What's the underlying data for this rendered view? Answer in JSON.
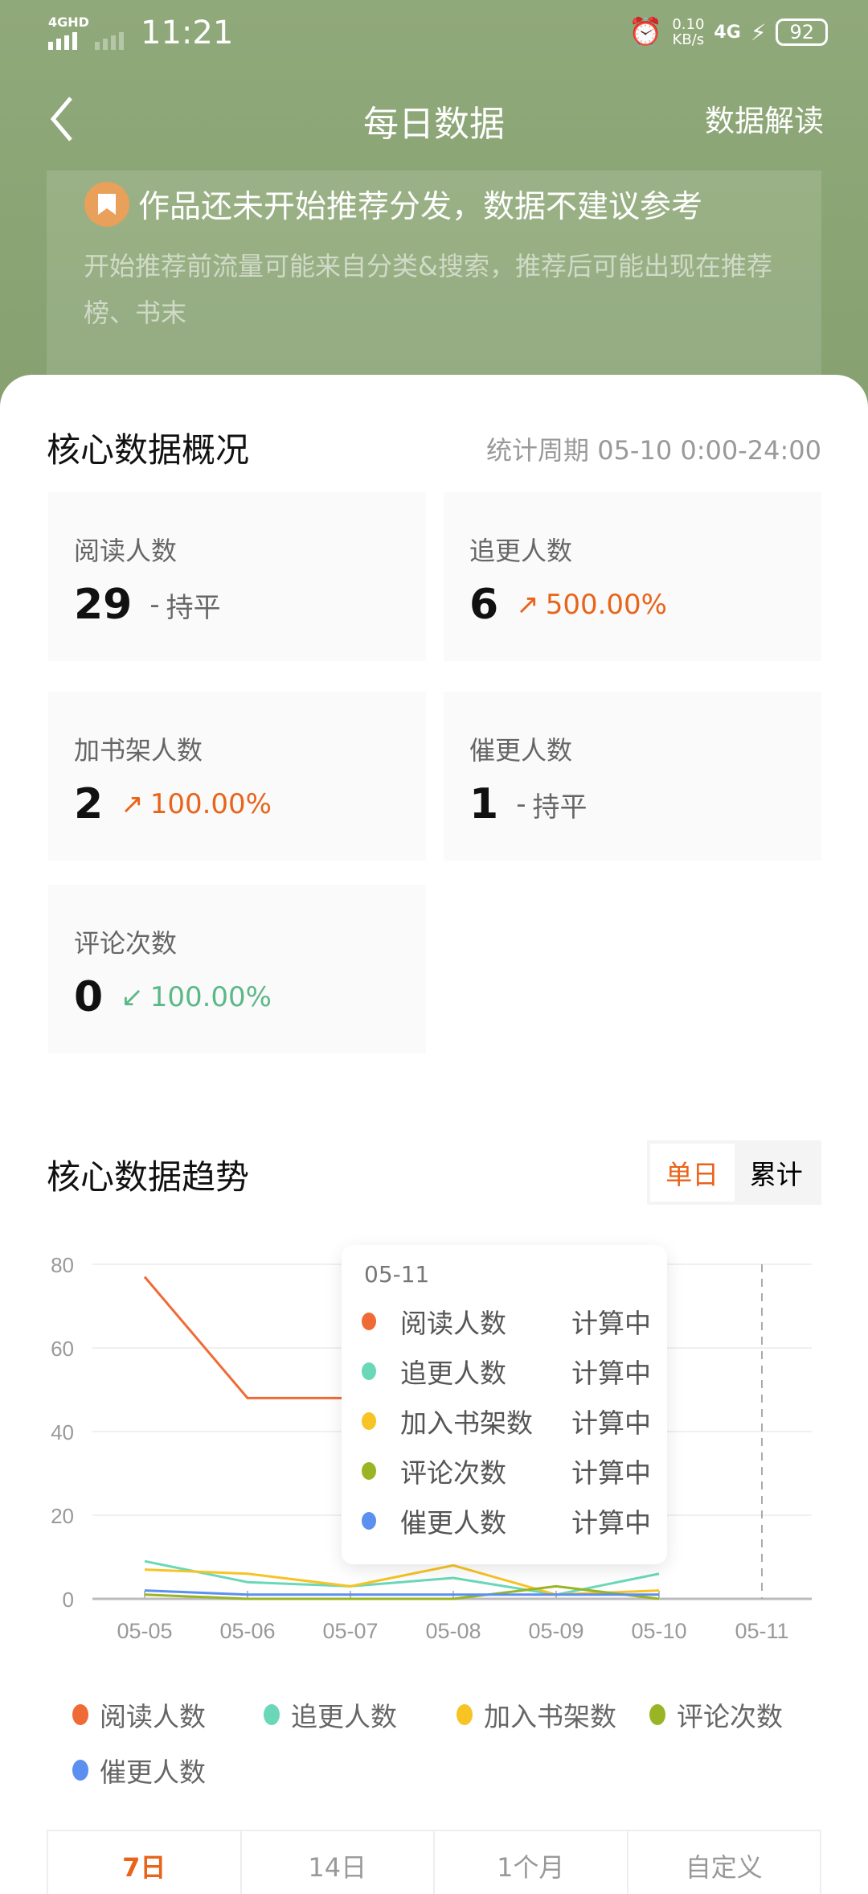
{
  "status_bar": {
    "network": "4GHD",
    "time": "11:21",
    "speed": "0.10",
    "speed_unit": "KB/s",
    "net2": "4G",
    "battery": "92"
  },
  "nav": {
    "title": "每日数据",
    "right": "数据解读"
  },
  "banner": {
    "title": "作品还未开始推荐分发，数据不建议参考",
    "subtitle": "开始推荐前流量可能来自分类&搜索，推荐后可能出现在推荐榜、书末"
  },
  "overview": {
    "title": "核心数据概况",
    "period": "统计周期 05-10 0:00-24:00",
    "stats": [
      {
        "label": "阅读人数",
        "value": "29",
        "change": "持平",
        "trend": "flat"
      },
      {
        "label": "追更人数",
        "value": "6",
        "change": "500.00%",
        "trend": "up"
      },
      {
        "label": "加书架人数",
        "value": "2",
        "change": "100.00%",
        "trend": "up"
      },
      {
        "label": "催更人数",
        "value": "1",
        "change": "持平",
        "trend": "flat"
      },
      {
        "label": "评论次数",
        "value": "0",
        "change": "100.00%",
        "trend": "down"
      }
    ]
  },
  "trend": {
    "title": "核心数据趋势",
    "toggle": [
      "单日",
      "累计"
    ],
    "active_toggle": "单日",
    "tooltip": {
      "date": "05-11",
      "rows": [
        {
          "name": "阅读人数",
          "value": "计算中"
        },
        {
          "name": "追更人数",
          "value": "计算中"
        },
        {
          "name": "加入书架数",
          "value": "计算中"
        },
        {
          "name": "评论次数",
          "value": "计算中"
        },
        {
          "name": "催更人数",
          "value": "计算中"
        }
      ]
    },
    "ranges": [
      "7日",
      "14日",
      "1个月",
      "自定义"
    ],
    "active_range": "7日"
  },
  "chart_data": {
    "type": "line",
    "categories": [
      "05-05",
      "05-06",
      "05-07",
      "05-08",
      "05-09",
      "05-10",
      "05-11"
    ],
    "yticks": [
      "0",
      "20",
      "40",
      "60",
      "80"
    ],
    "ylim": [
      0,
      80
    ],
    "grid": true,
    "legend": "bottom",
    "series": [
      {
        "name": "阅读人数",
        "color": "#f06a35",
        "values": [
          77,
          48,
          48,
          null,
          null,
          29,
          null
        ]
      },
      {
        "name": "追更人数",
        "color": "#6ad8b8",
        "values": [
          9,
          4,
          3,
          5,
          1,
          6,
          null
        ]
      },
      {
        "name": "加入书架数",
        "color": "#f7c325",
        "values": [
          7,
          6,
          3,
          8,
          1,
          2,
          null
        ]
      },
      {
        "name": "评论次数",
        "color": "#9ab523",
        "values": [
          1,
          0,
          0,
          0,
          3,
          0,
          null
        ]
      },
      {
        "name": "催更人数",
        "color": "#5b8ff0",
        "values": [
          2,
          1,
          1,
          1,
          1,
          1,
          null
        ]
      }
    ]
  }
}
